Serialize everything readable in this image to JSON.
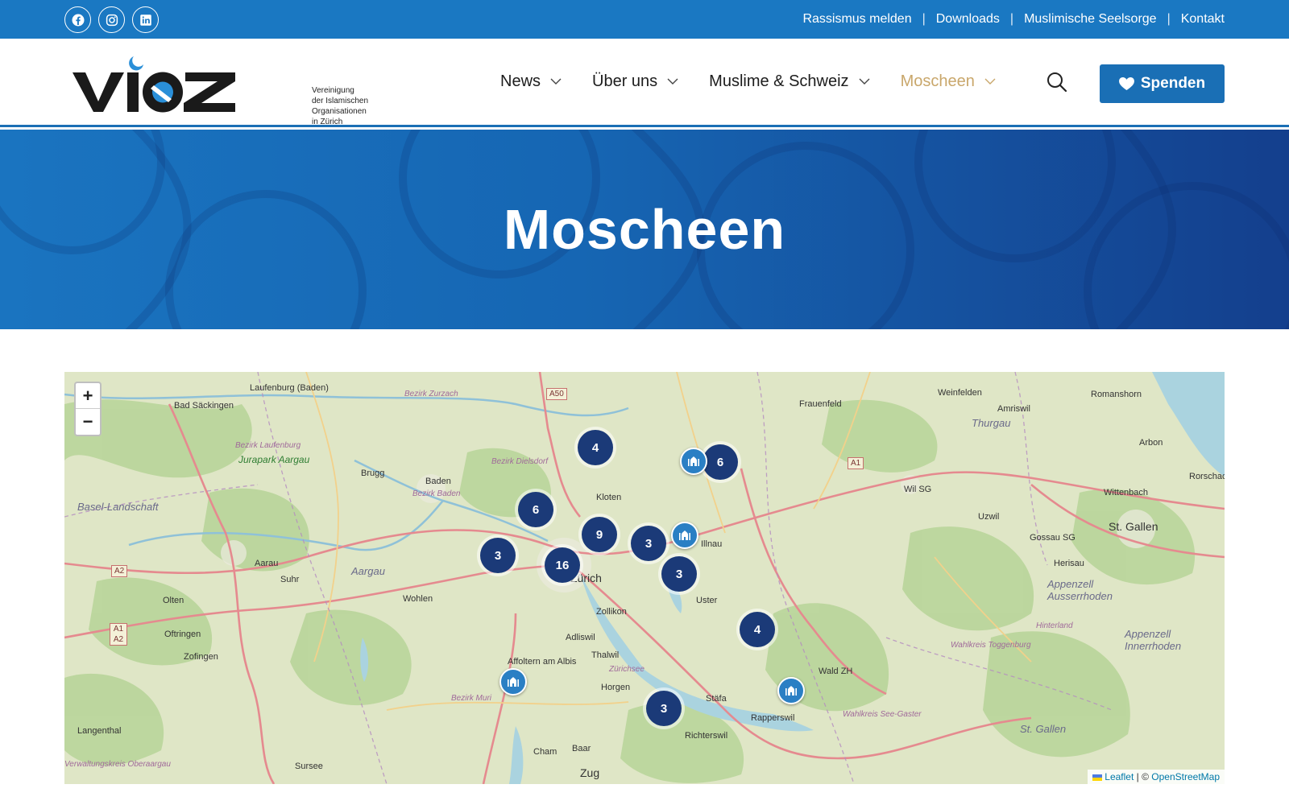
{
  "topbar": {
    "social_icons": [
      "facebook-icon",
      "instagram-icon",
      "linkedin-icon"
    ],
    "links": [
      "Rassismus melden",
      "Downloads",
      "Muslimische Seelsorge",
      "Kontakt"
    ]
  },
  "logo": {
    "wordmark": "VIOZ",
    "subtitle": [
      "Vereinigung",
      "der Islamischen",
      "Organisationen",
      "in Zürich"
    ]
  },
  "nav": {
    "items": [
      {
        "label": "News",
        "active": false
      },
      {
        "label": "Über uns",
        "active": false
      },
      {
        "label": "Muslime & Schweiz",
        "active": false
      },
      {
        "label": "Moscheen",
        "active": true
      }
    ],
    "search_icon": "search-icon",
    "donate_label": "Spenden",
    "accent_color": "#c9a76b",
    "brand_color": "#1a6fb5"
  },
  "hero": {
    "title": "Moscheen"
  },
  "map": {
    "zoom_in": "+",
    "zoom_out": "−",
    "clusters": [
      "4",
      "6",
      "6",
      "9",
      "3",
      "3",
      "16",
      "3",
      "4",
      "3"
    ],
    "attribution": {
      "leaflet": "Leaflet",
      "separator": "| ©",
      "osm": "OpenStreetMap"
    },
    "places": {
      "zurich": "Zürich",
      "st_gallen": "St. Gallen",
      "frauenfeld": "Frauenfeld",
      "weinfelden": "Weinfelden",
      "amriswil": "Amriswil",
      "romanshorn": "Romanshorn",
      "arbon": "Arbon",
      "rorschach": "Rorschac",
      "wittenbach": "Wittenbach",
      "wil": "Wil SG",
      "uzwil": "Uzwil",
      "gossau": "Gossau SG",
      "herisau": "Herisau",
      "appenzell_ar": "Appenzell Ausserrhoden",
      "appenzell_ir": "Appenzell Innerrhoden",
      "hinterland": "Hinterland",
      "thurgau": "Thurgau",
      "baden": "Baden",
      "brugg": "Brugg",
      "aarau": "Aarau",
      "suhr": "Suhr",
      "wohlen": "Wohlen",
      "aargau": "Aargau",
      "olten": "Olten",
      "oftringen": "Oftringen",
      "zofingen": "Zofingen",
      "langenthal": "Langenthal",
      "laufenburg": "Laufenburg (Baden)",
      "bad_saeckingen": "Bad Säckingen",
      "basel_landschaft": "Basel-Landschaft",
      "jurapark": "Jurapark Aargau",
      "kloten": "Kloten",
      "illnau": "Illnau",
      "uster": "Uster",
      "zollikon": "Zollikon",
      "adliswil": "Adliswil",
      "thalwil": "Thalwil",
      "horgen": "Horgen",
      "staefa": "Stäfa",
      "rapperswil": "Rapperswil",
      "richterswil": "Richterswil",
      "wald": "Wald ZH",
      "affoltern": "Affoltern am Albis",
      "baar": "Baar",
      "cham": "Cham",
      "zug": "Zug",
      "sursee": "Sursee",
      "bezirk_zurzach": "Bezirk Zurzach",
      "bezirk_dielsdorf": "Bezirk Dielsdorf",
      "bezirk_baden": "Bezirk Baden",
      "bezirk_laufenburg": "Bezirk Laufenburg",
      "bezirk_muri": "Bezirk Muri",
      "wahlkreis_toggenburg": "Wahlkreis Toggenburg",
      "wahlkreis_see": "Wahlkreis See-Gaster",
      "verwaltungskreis": "Verwaltungskreis Oberaargau",
      "zurichsee": "Zürichsee",
      "a50": "A50",
      "a1": "A1",
      "a2": "A2",
      "a1a2": "A1 A2"
    }
  }
}
